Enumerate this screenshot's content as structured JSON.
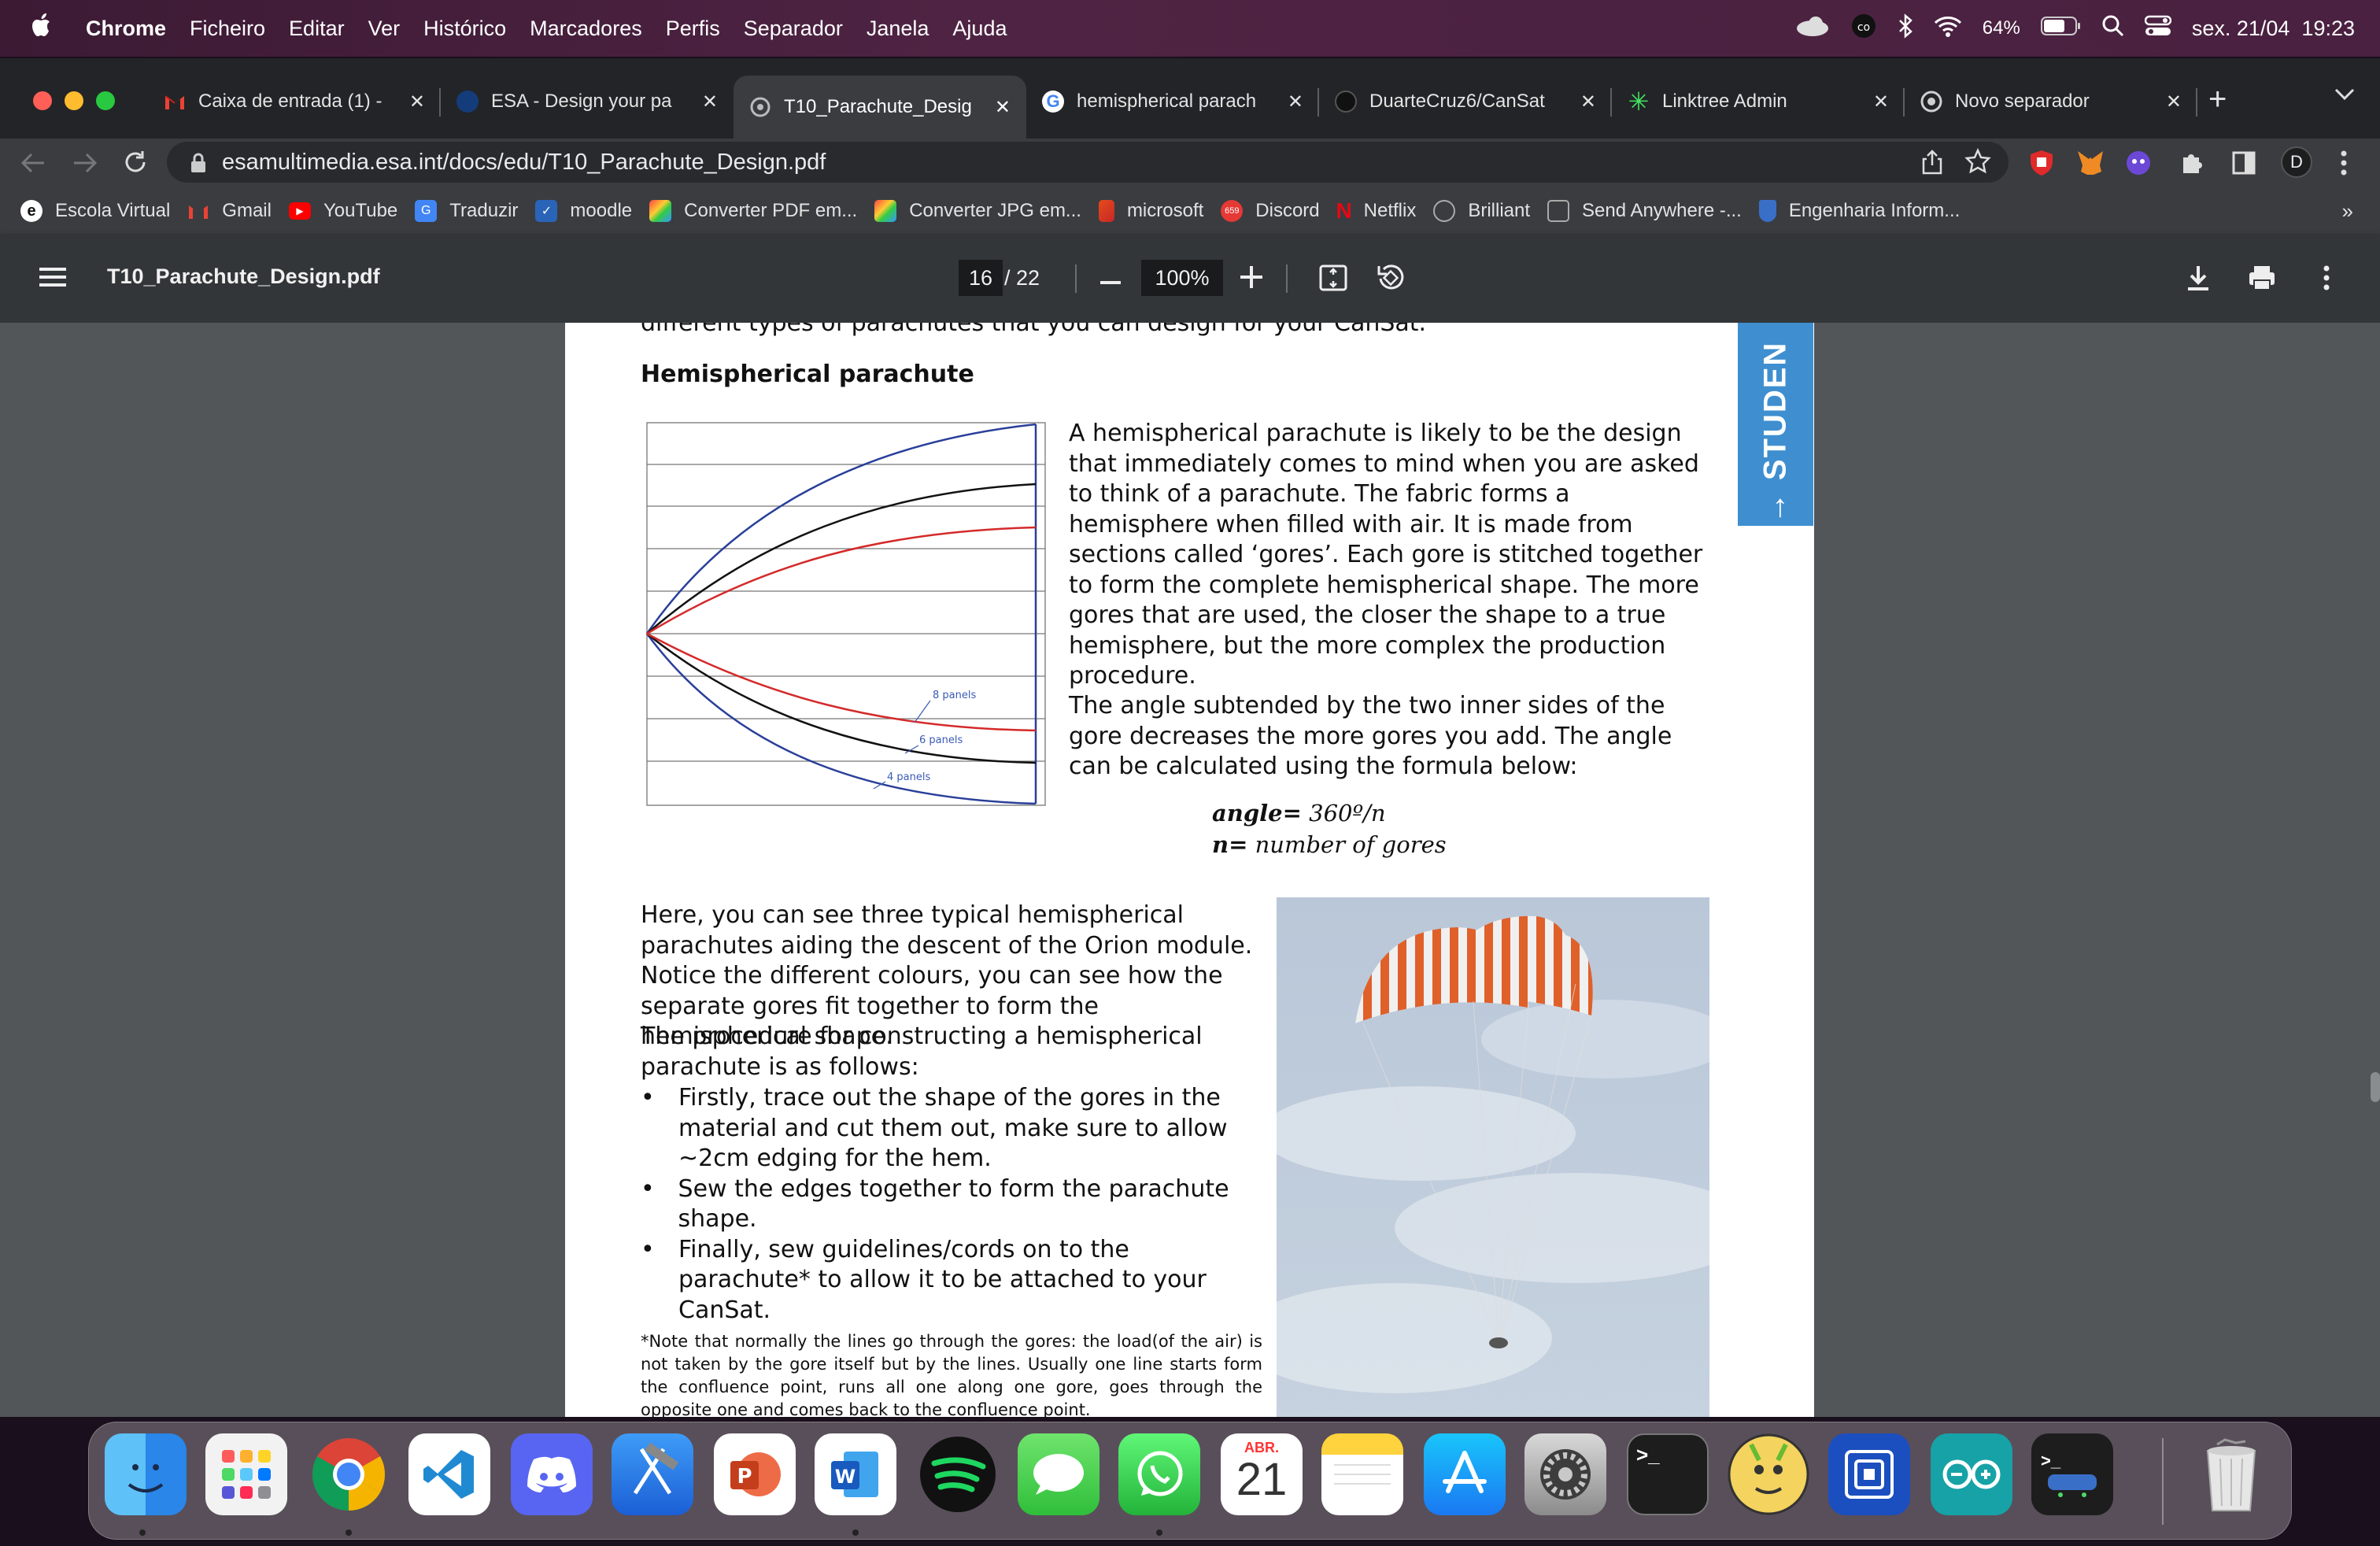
{
  "menubar": {
    "app": "Chrome",
    "items": [
      "Ficheiro",
      "Editar",
      "Ver",
      "Histórico",
      "Marcadores",
      "Perfis",
      "Separador",
      "Janela",
      "Ajuda"
    ],
    "battery": "64%",
    "datetime": "sex. 21/04  19:23"
  },
  "tabs": [
    {
      "title": "Caixa de entrada (1) -",
      "icon": "gmail-icon"
    },
    {
      "title": "ESA - Design your pa",
      "icon": "esa-icon"
    },
    {
      "title": "T10_Parachute_Desig",
      "icon": "pdf-icon",
      "active": true
    },
    {
      "title": "hemispherical parach",
      "icon": "google-icon"
    },
    {
      "title": "DuarteCruz6/CanSat",
      "icon": "github-icon"
    },
    {
      "title": "Linktree Admin",
      "icon": "linktree-icon"
    },
    {
      "title": "Novo separador",
      "icon": "chrome-icon"
    }
  ],
  "omnibox": {
    "url": "esamultimedia.esa.int/docs/edu/T10_Parachute_Design.pdf"
  },
  "profile_initial": "D",
  "bookmarks": [
    "Escola Virtual",
    "Gmail",
    "YouTube",
    "Traduzir",
    "moodle",
    "Converter PDF em...",
    "Converter JPG em...",
    "microsoft",
    "Discord",
    "Netflix",
    "Brilliant",
    "Send Anywhere -...",
    "Engenharia Inform..."
  ],
  "bookmarks_more": "»",
  "pdf": {
    "filename": "T10_Parachute_Design.pdf",
    "page_current": "16",
    "page_total": "/ 22",
    "zoom": "100%",
    "content": {
      "cut_line": "different types of parachutes that you can design for your CanSat.",
      "heading": "Hemispherical parachute",
      "para1": "A hemispherical parachute is likely to be the design that immediately comes to mind when you are asked to think of a parachute. The fabric forms a hemisphere when filled with air. It is made from sections called ‘gores’. Each gore is stitched together to form the complete hemispherical shape. The more gores that are used, the closer the shape to a true hemisphere, but the more complex the production procedure.",
      "para2": "The angle subtended by the two inner sides of the gore decreases the more gores you add. The angle can be calculated using the formula below:",
      "formula_angle_label": "angle=",
      "formula_angle_value": " 360º/n",
      "formula_n_label": "n=",
      "formula_n_value": " number of gores",
      "para3": "Here, you can see three typical hemispherical parachutes aiding the descent of the Orion module. Notice the different colours, you can see how the separate gores fit together to form the hemispherical shape.",
      "para4": "The procedure for constructing a hemispherical parachute is as follows:",
      "bullets": [
        "Firstly, trace out the shape of the gores in the material and cut them out, make sure to allow ~2cm edging for the hem.",
        "Sew the edges together to form the parachute shape.",
        "Finally, sew guidelines/cords on to the parachute* to allow it to be attached to your CanSat."
      ],
      "note": "*Note that normally the lines go through the gores: the load(of the air) is not taken by the gore itself but by the lines. Usually one line starts form the confluence point, runs all one along one gore, goes through the opposite one and comes back to the confluence point.",
      "side_tab": "→ STUDEN",
      "diagram_labels": [
        "8 panels",
        "6 panels",
        "4 panels"
      ]
    }
  },
  "colors": {
    "pdf_toolbar": "#323639",
    "viewer_bg": "#525659",
    "side_tab": "#3f8fd0",
    "gore_blue": "#2a3f9a",
    "gore_red": "#d42a2a"
  },
  "dock": {
    "calendar_month": "ABR.",
    "calendar_day": "21",
    "apps": [
      "finder-icon",
      "launchpad-icon",
      "chrome-icon",
      "vscode-icon",
      "discord-icon",
      "xcode-icon",
      "powerpoint-icon",
      "word-icon",
      "spotify-icon",
      "messages-icon",
      "whatsapp-icon",
      "calendar-icon",
      "notes-icon",
      "appstore-icon",
      "settings-icon",
      "terminal-icon",
      "brave-game-icon",
      "virtualbox-icon",
      "arduino-icon",
      "serial-icon",
      "trash-icon"
    ]
  }
}
